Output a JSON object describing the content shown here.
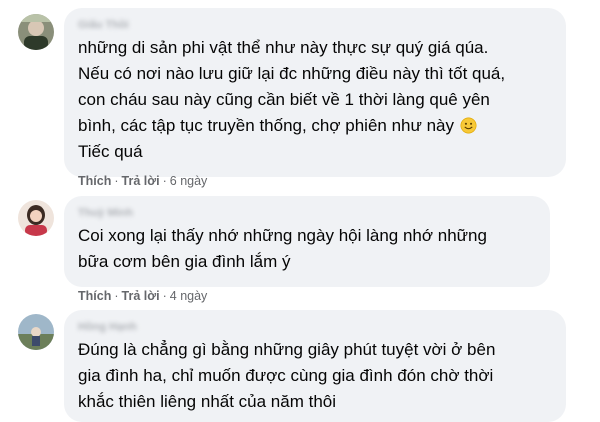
{
  "comments": [
    {
      "author": "Giấu Thồi",
      "text": "những di sản phi vật thể như này thực sự quý giá qúa.\nNếu có nơi nào lưu giữ lại đc những điều này thì tốt quá,\ncon cháu sau này cũng cần biết về 1 thời làng quê yên\nbình, các tập tục truyền thống, chợ phiên như này",
      "text_tail": "Tiếc quá",
      "emoji": "slightly-smiling-face-emoji",
      "like_label": "Thích",
      "reply_label": "Trả lời",
      "time": "6 ngày"
    },
    {
      "author": "Thuỳ Minh",
      "text": "Coi xong lại thấy nhớ những ngày hội làng nhớ những\nbữa cơm bên gia đình lắm ý",
      "like_label": "Thích",
      "reply_label": "Trả lời",
      "time": "4 ngày"
    },
    {
      "author": "Hồng Hạnh",
      "text": "Đúng là chẳng gì bằng những giây phút tuyệt vời ở bên\ngia đình ha, chỉ muốn được cùng gia đình đón chờ thời\nkhắc thiên liêng nhất của năm thôi"
    }
  ],
  "separator": "·",
  "colors": {
    "bubble_bg": "#f0f2f5",
    "text": "#050505",
    "meta": "#65676b"
  }
}
